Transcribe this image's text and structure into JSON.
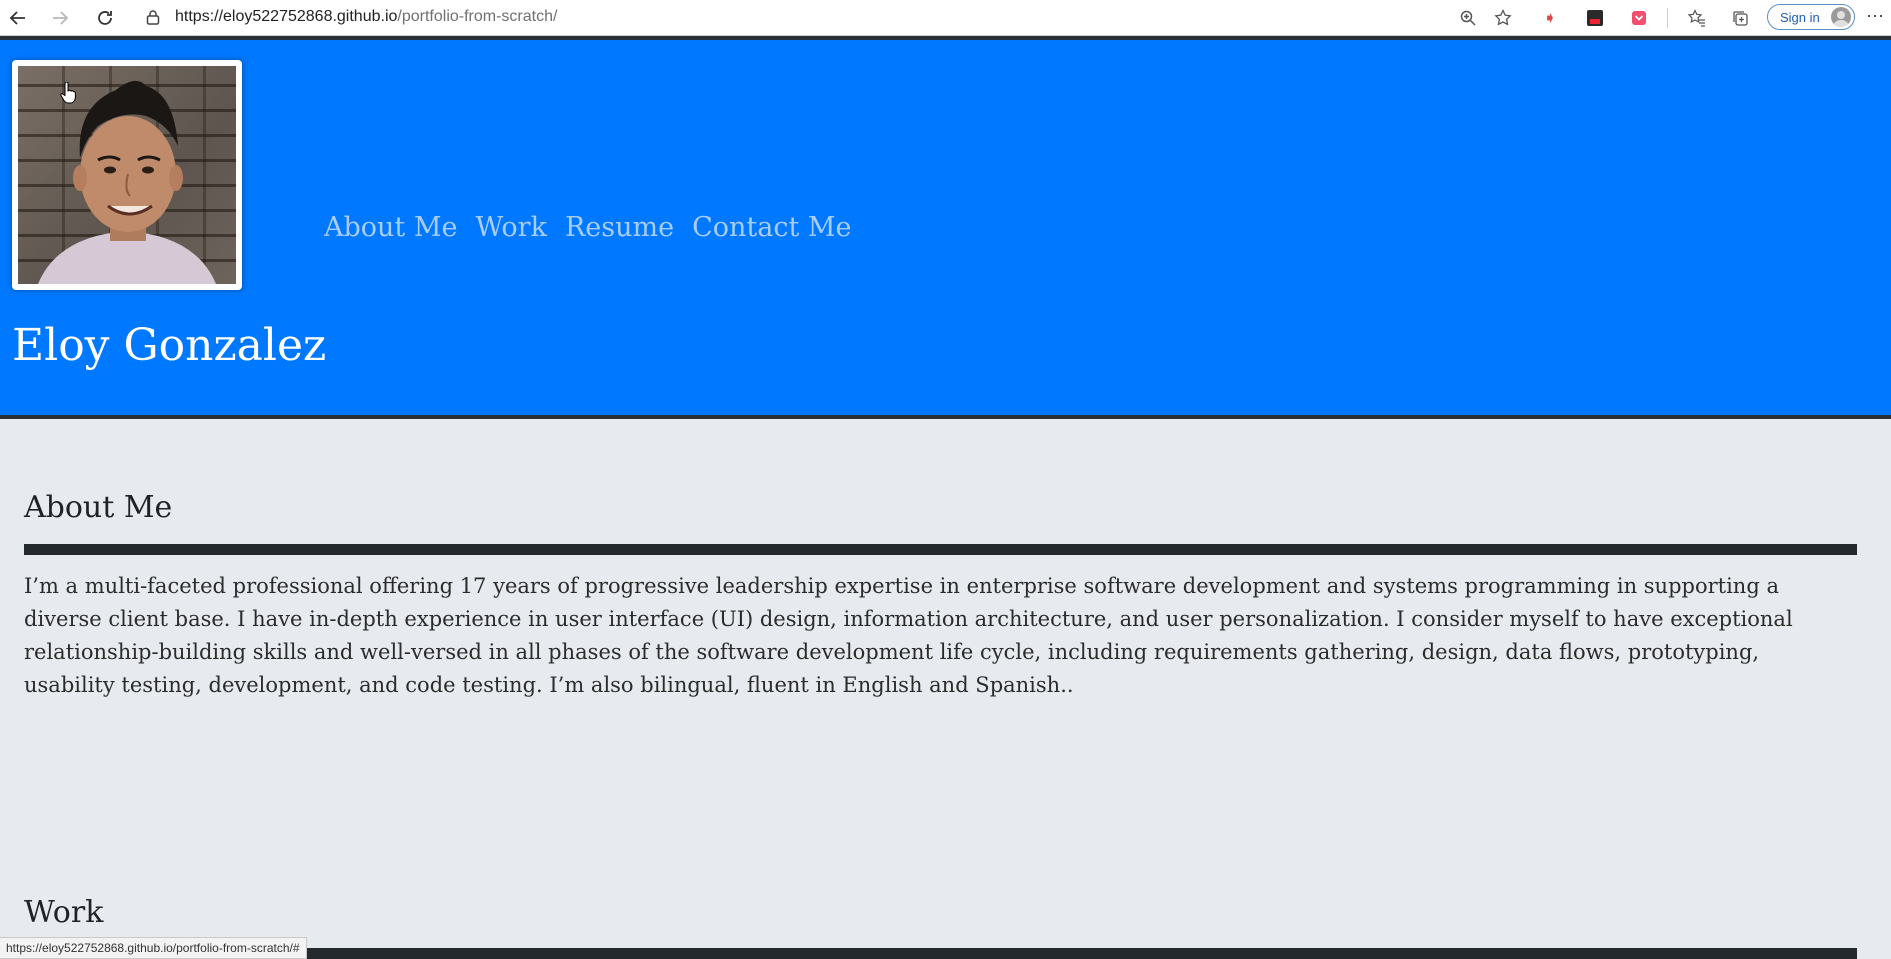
{
  "browser": {
    "url_host": "https://eloy522752868.github.io",
    "url_path": "/portfolio-from-scratch/",
    "sign_in_label": "Sign in",
    "status_url": "https://eloy522752868.github.io/portfolio-from-scratch/#",
    "icons": [
      "back-icon",
      "forward-icon",
      "refresh-icon",
      "lock-icon",
      "zoom-icon",
      "favorite-add-icon",
      "extension-icon",
      "extension-off-icon",
      "extension-pocket-icon",
      "favorites-icon",
      "collections-icon",
      "profile-icon",
      "more-icon"
    ]
  },
  "header": {
    "name": "Eloy Gonzalez",
    "nav": [
      "About Me",
      "Work",
      "Resume",
      "Contact Me"
    ],
    "bg_color": "#0078ff",
    "nav_color": "#a9cdf2"
  },
  "about": {
    "title": "About Me",
    "text": "I’m a multi-faceted professional offering 17 years of progressive leadership expertise in enterprise software development and systems programming in supporting a diverse client base. I have in-depth experience in user interface (UI) design, information architecture, and user personalization. I consider myself to have exceptional relationship-building skills and well-versed in all phases of the software development life cycle, including requirements gathering, design, data flows, prototyping, usability testing, development, and code testing. I’m also bilingual, fluent in English and Spanish.."
  },
  "work": {
    "title": "Work"
  }
}
